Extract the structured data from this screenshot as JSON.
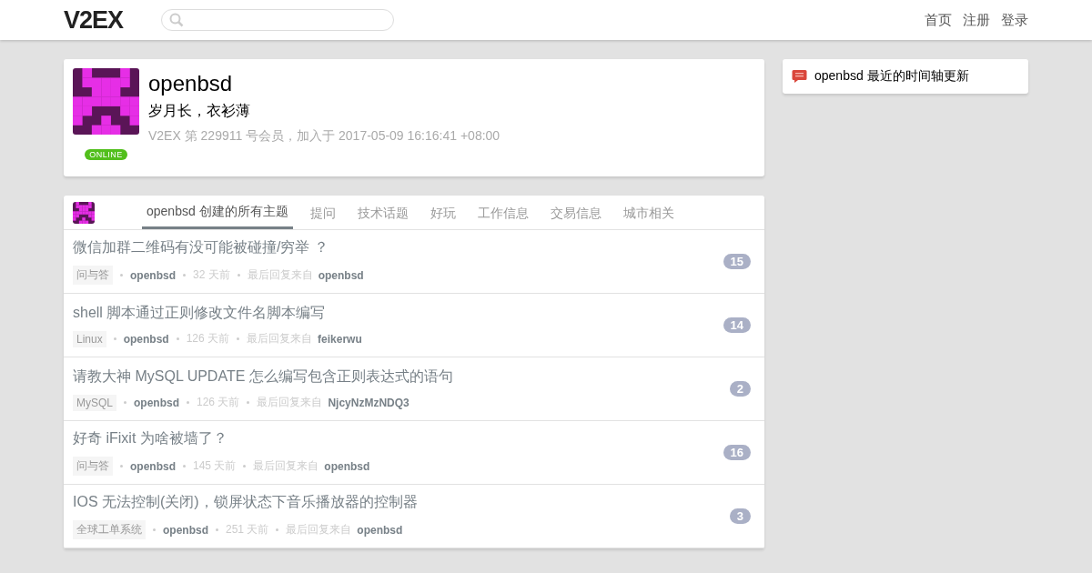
{
  "header": {
    "logo": "V2EX",
    "nav": [
      "首页",
      "注册",
      "登录"
    ]
  },
  "profile": {
    "username": "openbsd",
    "tagline": "岁月长，衣衫薄",
    "member_info": "V2EX 第 229911 号会员，加入于 2017-05-09 16:16:41 +08:00",
    "online": true,
    "online_label": "ONLINE"
  },
  "tabs": [
    {
      "label": "openbsd 创建的所有主题",
      "selected": true
    },
    {
      "label": "提问",
      "selected": false
    },
    {
      "label": "技术话题",
      "selected": false
    },
    {
      "label": "好玩",
      "selected": false
    },
    {
      "label": "工作信息",
      "selected": false
    },
    {
      "label": "交易信息",
      "selected": false
    },
    {
      "label": "城市相关",
      "selected": false
    }
  ],
  "topics": [
    {
      "title": "微信加群二维码有没可能被碰撞/穷举 ？",
      "node": "问与答",
      "author": "openbsd",
      "time": "32 天前",
      "last_reply_label": "最后回复来自",
      "last_reply_by": "openbsd",
      "replies": "15"
    },
    {
      "title": "shell 脚本通过正则修改文件名脚本编写",
      "node": "Linux",
      "author": "openbsd",
      "time": "126 天前",
      "last_reply_label": "最后回复来自",
      "last_reply_by": "feikerwu",
      "replies": "14"
    },
    {
      "title": "请教大神 MySQL UPDATE 怎么编写包含正则表达式的语句",
      "node": "MySQL",
      "author": "openbsd",
      "time": "126 天前",
      "last_reply_label": "最后回复来自",
      "last_reply_by": "NjcyNzMzNDQ3",
      "replies": "2"
    },
    {
      "title": "好奇 iFixit 为啥被墙了？",
      "node": "问与答",
      "author": "openbsd",
      "time": "145 天前",
      "last_reply_label": "最后回复来自",
      "last_reply_by": "openbsd",
      "replies": "16"
    },
    {
      "title": "IOS 无法控制(关闭)，锁屏状态下音乐播放器的控制器",
      "node": "全球工单系统",
      "author": "openbsd",
      "time": "251 天前",
      "last_reply_label": "最后回复来自",
      "last_reply_by": "openbsd",
      "replies": "3"
    }
  ],
  "sidebar": {
    "timeline_link": "openbsd 最近的时间轴更新"
  }
}
